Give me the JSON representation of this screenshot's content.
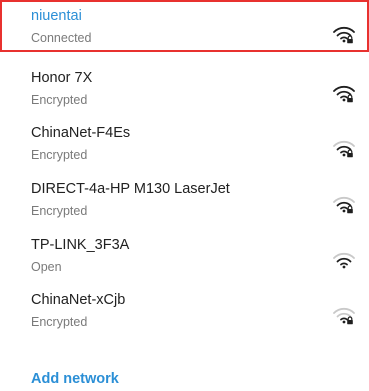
{
  "networks": [
    {
      "name": "niuentai",
      "status": "Connected",
      "icon": "wifi-signal-full-lock-icon",
      "selected": true
    },
    {
      "name": "Honor 7X",
      "status": "Encrypted",
      "icon": "wifi-signal-full-lock-icon"
    },
    {
      "name": "ChinaNet-F4Es",
      "status": "Encrypted",
      "icon": "wifi-signal-medium-lock-icon"
    },
    {
      "name": "DIRECT-4a-HP M130 LaserJet",
      "status": "Encrypted",
      "icon": "wifi-signal-medium-lock-icon"
    },
    {
      "name": "TP-LINK_3F3A",
      "status": "Open",
      "icon": "wifi-signal-medium-icon"
    },
    {
      "name": "ChinaNet-xCjb",
      "status": "Encrypted",
      "icon": "wifi-signal-low-lock-icon"
    }
  ],
  "add_network_label": "Add network",
  "colors": {
    "accent": "#2b8fd6",
    "selection_border": "#e8312f",
    "primary_text": "#212121",
    "secondary_text": "#7a7a7a",
    "icon_dark": "#1f1f1f",
    "icon_dim": "#c9c9c9"
  }
}
